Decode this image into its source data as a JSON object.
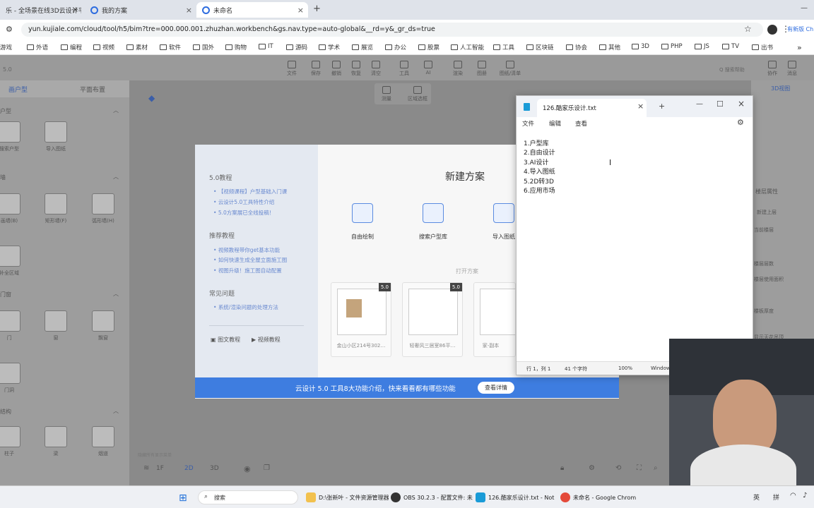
{
  "browser": {
    "tabs": [
      {
        "label": "乐 - 全场景在线3D云设计平…"
      },
      {
        "label": "我的方案"
      },
      {
        "label": "未命名"
      }
    ],
    "new_tab": "+",
    "url": "yun.kujiale.com/cloud/tool/h5/bim?tre=000.000.001.zhuzhan.workbench&gs.nav.type=auto-global&__rd=y&_gr_ds=true",
    "profile_label": "有新版 Ch",
    "min": "—",
    "bookmarks": [
      "游戏",
      "外语",
      "编程",
      "视频",
      "素材",
      "软件",
      "国外",
      "购物",
      "IT",
      "源码",
      "学术",
      "展览",
      "办公",
      "股票",
      "人工智能",
      "工具",
      "区块链",
      "协会",
      "其他",
      "3D",
      "PHP",
      "JS",
      "TV",
      "出书"
    ],
    "bookmarks_more": "»"
  },
  "app": {
    "version": "5.0",
    "toolbar": [
      {
        "label": "文件"
      },
      {
        "label": "保存"
      },
      {
        "label": "撤销"
      },
      {
        "label": "恢复"
      },
      {
        "label": "清空"
      },
      {
        "label": "工具"
      },
      {
        "label": "AI"
      },
      {
        "label": "渲染"
      },
      {
        "label": "图册"
      },
      {
        "label": "图纸/清单"
      }
    ],
    "search_help": "Q 搜索帮助",
    "right_tools": [
      "协作",
      "消息"
    ],
    "sub_tools": [
      "测量",
      "区域选框"
    ],
    "left_tabs": [
      "画户型",
      "平面布置"
    ],
    "right_tab": "3D视图",
    "sections": [
      {
        "title": "户型",
        "items": [
          "搜索户型",
          "导入图纸"
        ]
      },
      {
        "title": "墙",
        "items": [
          "画墙(B)",
          "矩形墙(F)",
          "弧形墙(H)",
          "补全区域"
        ]
      },
      {
        "title": "门窗",
        "items": [
          "门",
          "窗",
          "飘窗",
          "门洞"
        ]
      },
      {
        "title": "结构",
        "items": [
          "柱子",
          "梁",
          "烟道"
        ]
      }
    ],
    "right_panel": [
      "楼层属性",
      "新建上层",
      "当前楼层",
      "楼层层数",
      "楼层使用面积",
      "楼板厚度",
      "显示天花吊顶"
    ],
    "bottom": {
      "floor": "1F",
      "view2d": "2D",
      "view3d": "3D",
      "help": "隐藏所有显示菜单"
    }
  },
  "dialog": {
    "title": "新建方案",
    "sections": [
      {
        "title": "5.0教程",
        "links": [
          "【视频课程】户型基础入门课",
          "云设计5.0工具特性介绍",
          "5.0方案展已全线投稿！"
        ]
      },
      {
        "title": "推荐教程",
        "links": [
          "视频教程带你get基本功能",
          "如何快速生成全屋立面施工图",
          "视图升级！施工图自动配置"
        ]
      },
      {
        "title": "常见问题",
        "links": [
          "系统/渲染问题的处理方法"
        ]
      }
    ],
    "footer_links": [
      "图文教程",
      "视频教程"
    ],
    "create_options": [
      "自由绘制",
      "搜索户型库",
      "导入图纸"
    ],
    "open_label": "打开方案",
    "plans": [
      {
        "badge": "5.0",
        "caption": "金山小区214号302…"
      },
      {
        "badge": "5.0",
        "caption": "轻奢风三居室86平…"
      },
      {
        "badge": "",
        "caption": "家-副本"
      }
    ],
    "banner_text": "云设计 5.0 工具8大功能介绍，快来看看都有哪些功能",
    "banner_button": "查看详情"
  },
  "notepad": {
    "tab_title": "126.酷家乐设计.txt",
    "menu": [
      "文件",
      "编辑",
      "查看"
    ],
    "lines": [
      "1.户型库",
      "2.自由设计",
      "3.AI设计",
      "4.导入图纸",
      "5.2D转3D",
      "6.应用市场"
    ],
    "status": [
      "行 1，列 1",
      "41 个字符",
      "100%",
      "Windows"
    ]
  },
  "taskbar": {
    "search": "搜索",
    "items": [
      {
        "label": "D:\\张新叶 - 文件资源管理器"
      },
      {
        "label": "OBS 30.2.3 - 配置文件: 未"
      },
      {
        "label": "126.酷家乐设计.txt - Not"
      },
      {
        "label": "未命名 - Google Chrom"
      }
    ],
    "tray_lang": "英",
    "tray_ime": "拼"
  },
  "colors": {
    "accent": "#3e7de0",
    "tab_bg": "#dfe3ea",
    "overlay": "#8a8a8a"
  }
}
